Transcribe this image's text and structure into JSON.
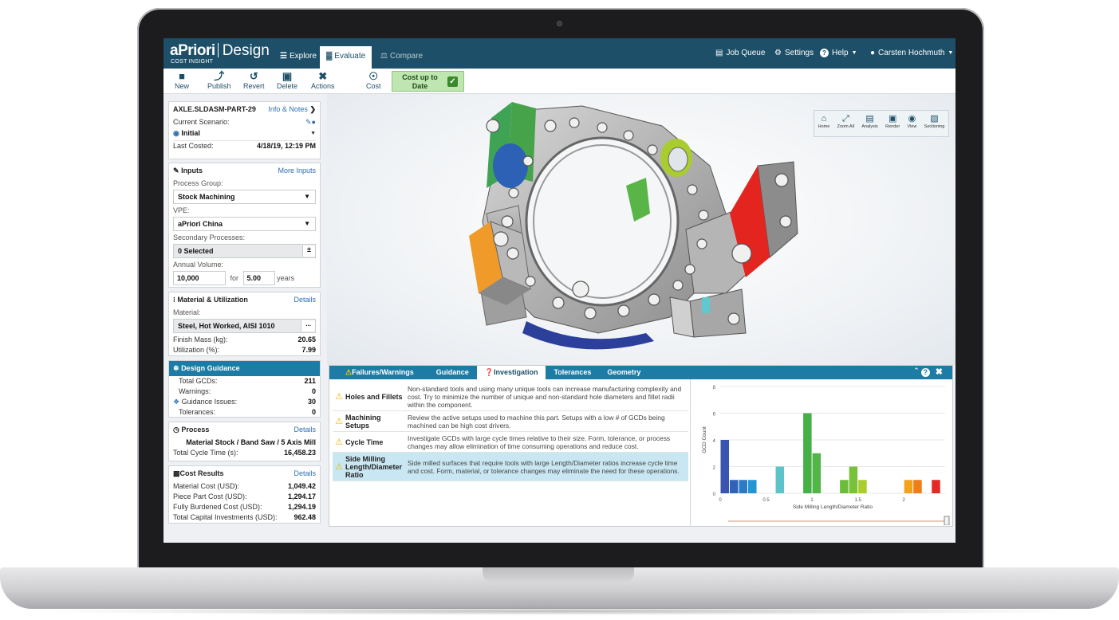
{
  "nav": {
    "logo_brand": "aPriori",
    "logo_product": "Design",
    "logo_sub": "COST INSIGHT",
    "tabs": [
      {
        "label": "Explore"
      },
      {
        "label": "Evaluate"
      },
      {
        "label": "Compare"
      }
    ],
    "right": {
      "job_queue": "Job Queue",
      "settings": "Settings",
      "help": "Help",
      "user": "Carsten Hochmuth"
    }
  },
  "toolbar": {
    "new": "New",
    "publish": "Publish",
    "revert": "Revert",
    "delete": "Delete",
    "actions": "Actions",
    "cost": "Cost",
    "cost_status_line1": "Cost up to",
    "cost_status_line2": "Date"
  },
  "part": {
    "name": "AXLE.SLDASM-PART-29",
    "info_link": "Info & Notes",
    "scenario_label": "Current Scenario:",
    "scenario_value": "Initial",
    "last_costed_label": "Last Costed:",
    "last_costed_value": "4/18/19, 12:19 PM"
  },
  "inputs": {
    "title": "Inputs",
    "more": "More Inputs",
    "process_group_label": "Process Group:",
    "process_group_value": "Stock Machining",
    "vpe_label": "VPE:",
    "vpe_value": "aPriori China",
    "secondary_label": "Secondary Processes:",
    "secondary_value": "0 Selected",
    "secondary_btn": "±",
    "annual_label": "Annual Volume:",
    "annual_value": "10,000",
    "for_label": "for",
    "years_value": "5.00",
    "years_label": "years"
  },
  "material": {
    "title": "Material & Utilization",
    "details": "Details",
    "material_label": "Material:",
    "material_value": "Steel, Hot Worked, AISI 1010",
    "material_btn": "...",
    "finish_mass_label": "Finish Mass (kg):",
    "finish_mass_value": "20.65",
    "utilization_label": "Utilization (%):",
    "utilization_value": "7.99"
  },
  "guidance": {
    "title": "Design Guidance",
    "total_gcds_label": "Total GCDs:",
    "total_gcds_value": "211",
    "warnings_label": "Warnings:",
    "warnings_value": "0",
    "issues_label": "Guidance Issues:",
    "issues_value": "30",
    "tolerances_label": "Tolerances:",
    "tolerances_value": "0"
  },
  "process": {
    "title": "Process",
    "details": "Details",
    "routing": "Material Stock / Band Saw / 5 Axis Mill",
    "cycle_label": "Total Cycle Time (s):",
    "cycle_value": "16,458.23"
  },
  "cost": {
    "title": "Cost Results",
    "details": "Details",
    "rows": [
      {
        "label": "Material Cost (USD):",
        "value": "1,049.42"
      },
      {
        "label": "Piece Part Cost (USD):",
        "value": "1,294.17"
      },
      {
        "label": "Fully Burdened Cost (USD):",
        "value": "1,294.19"
      },
      {
        "label": "Total Capital Investments (USD):",
        "value": "962.48"
      }
    ]
  },
  "viewer_tools": [
    "Home",
    "Zoom All",
    "Analysis",
    "Render",
    "View",
    "Sectioning"
  ],
  "bottom": {
    "tabs": [
      {
        "label": "Failures/Warnings"
      },
      {
        "label": "Guidance"
      },
      {
        "label": "Investigation"
      },
      {
        "label": "Tolerances"
      },
      {
        "label": "Geometry"
      }
    ],
    "items": [
      {
        "name": "Holes and Fillets",
        "desc": "Non-standard tools and using many unique tools can increase manufacturing complexity and cost. Try to minimize the number of unique and non-standard hole diameters and fillet radii within the component."
      },
      {
        "name": "Machining Setups",
        "desc": "Review the active setups used to machine this part. Setups with a low # of GCDs being machined can be high cost drivers."
      },
      {
        "name": "Cycle Time",
        "desc": "Investigate GCDs with large cycle times relative to their size. Form, tolerance, or process changes may allow elimination of time consuming operations and reduce cost."
      },
      {
        "name": "Side Milling Length/Diameter Ratio",
        "desc": "Side milled surfaces that require tools with large Length/Diameter ratios increase cycle time and cost. Form, material, or tolerance changes may eliminate the need for these operations."
      }
    ]
  },
  "chart_data": {
    "type": "bar",
    "xlabel": "Side Milling Length/Diameter Ratio",
    "ylabel": "GCD Count",
    "xlim": [
      0,
      2.45
    ],
    "ylim": [
      0,
      8
    ],
    "xticks": [
      "0",
      "0.5",
      "1",
      "1.5",
      "2"
    ],
    "yticks": [
      "0",
      "2",
      "4",
      "6",
      "8"
    ],
    "bars": [
      {
        "x": 0.05,
        "value": 4,
        "color": "#3a55b0"
      },
      {
        "x": 0.15,
        "value": 1,
        "color": "#3063b8"
      },
      {
        "x": 0.25,
        "value": 1,
        "color": "#2a7ac5"
      },
      {
        "x": 0.35,
        "value": 1,
        "color": "#2295d2"
      },
      {
        "x": 0.65,
        "value": 2,
        "color": "#5ec3c8"
      },
      {
        "x": 0.95,
        "value": 6,
        "color": "#45b045"
      },
      {
        "x": 1.05,
        "value": 3,
        "color": "#52b548"
      },
      {
        "x": 1.35,
        "value": 1,
        "color": "#6cbc3a"
      },
      {
        "x": 1.45,
        "value": 2,
        "color": "#79c13a"
      },
      {
        "x": 1.55,
        "value": 1,
        "color": "#a9cc2e"
      },
      {
        "x": 2.05,
        "value": 1,
        "color": "#f3a21d"
      },
      {
        "x": 2.15,
        "value": 1,
        "color": "#ef7d1a"
      },
      {
        "x": 2.35,
        "value": 1,
        "color": "#e42a24"
      }
    ]
  }
}
